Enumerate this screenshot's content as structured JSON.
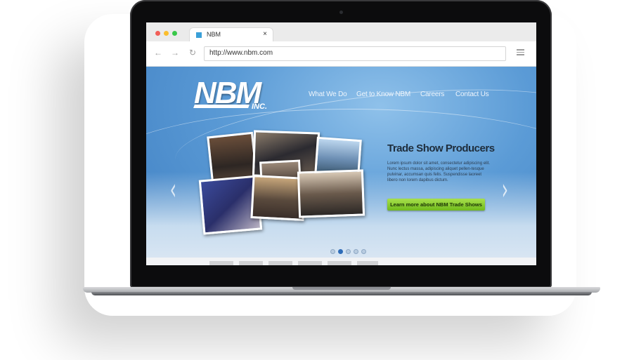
{
  "browser": {
    "tab_title": "NBM",
    "tab_close": "×",
    "back": "←",
    "forward": "→",
    "reload": "↻",
    "url": "http://www.nbm.com"
  },
  "site": {
    "logo": "NBM",
    "logo_suffix": "INC.",
    "nav": [
      "What We Do",
      "Get to Know NBM",
      "Careers",
      "Contact Us"
    ],
    "headline": "Trade Show Producers",
    "body": "Lorem ipsum dolor sit amet, consectetur adipiscing elit. Nunc lectus massa, adipiscing aliquet pellen-tesque pulvinar, accumsan quis felis. Suspendisse laoreet libero non lorem dapibus dictum.",
    "cta": "Learn more about NBM Trade Shows",
    "prev_arrow": "‹",
    "next_arrow": "›",
    "slide_count": 5,
    "active_slide": 2
  }
}
